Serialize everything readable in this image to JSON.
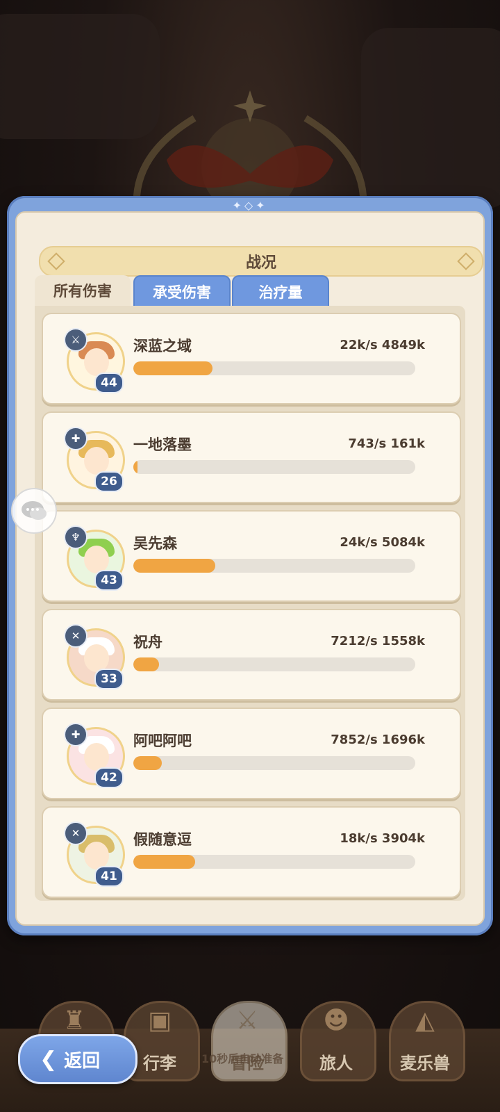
{
  "panel": {
    "title": "战况"
  },
  "tabs": [
    {
      "label": "所有伤害",
      "active": true
    },
    {
      "label": "承受伤害",
      "active": false
    },
    {
      "label": "治疗量",
      "active": false
    }
  ],
  "entries": [
    {
      "name": "深蓝之域",
      "stats": "22k/s 4849k",
      "level": "44",
      "class_icon": "sword-icon",
      "progress": 0.28,
      "hair": "#d98a53",
      "bg": "#fff6df"
    },
    {
      "name": "一地落墨",
      "stats": "743/s 161k",
      "level": "26",
      "class_icon": "cross-icon",
      "progress": 0.01,
      "hair": "#e7b95b",
      "bg": "#fff4e0"
    },
    {
      "name": "吴先森",
      "stats": "24k/s 5084k",
      "level": "43",
      "class_icon": "staff-icon",
      "progress": 0.29,
      "hair": "#8fcf4f",
      "bg": "#eaf6df"
    },
    {
      "name": "祝舟",
      "stats": "7212/s 1558k",
      "level": "33",
      "class_icon": "swords-icon",
      "progress": 0.09,
      "hair": "#ffffff",
      "bg": "#f6d9c8"
    },
    {
      "name": "阿吧阿吧",
      "stats": "7852/s 1696k",
      "level": "42",
      "class_icon": "cross-icon",
      "progress": 0.1,
      "hair": "#ffffff",
      "bg": "#fbe3e3"
    },
    {
      "name": "假随意逗",
      "stats": "18k/s 3904k",
      "level": "41",
      "class_icon": "swords-icon",
      "progress": 0.22,
      "hair": "#d9bd6a",
      "bg": "#eef3e3"
    }
  ],
  "bottom_nav": [
    {
      "label": "",
      "icon": "castle-icon"
    },
    {
      "label": "行李",
      "icon": "bag-icon"
    },
    {
      "label": "冒险",
      "icon": "crossed-swords-icon"
    },
    {
      "label": "旅人",
      "icon": "hero-icon"
    },
    {
      "label": "麦乐兽",
      "icon": "fox-icon"
    }
  ],
  "center_overlay": "10秒后自动准备",
  "back_button": {
    "label": "返回"
  }
}
